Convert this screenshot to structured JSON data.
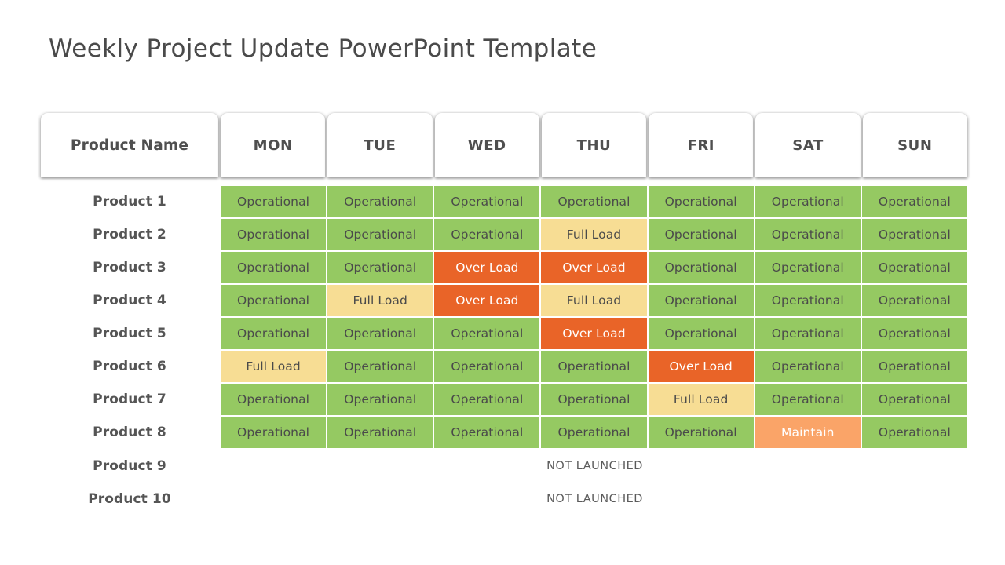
{
  "slide": {
    "title": "Weekly Project Update PowerPoint Template"
  },
  "colors": {
    "operational": "#95c962",
    "full_load": "#f7dd94",
    "over_load": "#e96428",
    "maintain": "#faa468",
    "title_text": "#4a4a4a",
    "header_text": "#4f4f4f",
    "row_label_text": "#555555",
    "background": "#ffffff"
  },
  "table": {
    "headers": [
      {
        "label": "Product Name",
        "name": "header-product-name"
      },
      {
        "label": "MON",
        "name": "header-mon"
      },
      {
        "label": "TUE",
        "name": "header-tue"
      },
      {
        "label": "WED",
        "name": "header-wed"
      },
      {
        "label": "THU",
        "name": "header-thu"
      },
      {
        "label": "FRI",
        "name": "header-fri"
      },
      {
        "label": "SAT",
        "name": "header-sat"
      },
      {
        "label": "SUN",
        "name": "header-sun"
      }
    ],
    "status_labels": {
      "operational": "Operational",
      "full_load": "Full Load",
      "over_load": "Over Load",
      "maintain": "Maintain",
      "not_launched": "NOT LAUNCHED"
    },
    "rows": [
      {
        "product": "Product 1",
        "launched": true,
        "cells": [
          {
            "label": "Operational",
            "status": "operational"
          },
          {
            "label": "Operational",
            "status": "operational"
          },
          {
            "label": "Operational",
            "status": "operational"
          },
          {
            "label": "Operational",
            "status": "operational"
          },
          {
            "label": "Operational",
            "status": "operational"
          },
          {
            "label": "Operational",
            "status": "operational"
          },
          {
            "label": "Operational",
            "status": "operational"
          }
        ]
      },
      {
        "product": "Product 2",
        "launched": true,
        "cells": [
          {
            "label": "Operational",
            "status": "operational"
          },
          {
            "label": "Operational",
            "status": "operational"
          },
          {
            "label": "Operational",
            "status": "operational"
          },
          {
            "label": "Full Load",
            "status": "full"
          },
          {
            "label": "Operational",
            "status": "operational"
          },
          {
            "label": "Operational",
            "status": "operational"
          },
          {
            "label": "Operational",
            "status": "operational"
          }
        ]
      },
      {
        "product": "Product 3",
        "launched": true,
        "cells": [
          {
            "label": "Operational",
            "status": "operational"
          },
          {
            "label": "Operational",
            "status": "operational"
          },
          {
            "label": "Over Load",
            "status": "over"
          },
          {
            "label": "Over Load",
            "status": "over"
          },
          {
            "label": "Operational",
            "status": "operational"
          },
          {
            "label": "Operational",
            "status": "operational"
          },
          {
            "label": "Operational",
            "status": "operational"
          }
        ]
      },
      {
        "product": "Product 4",
        "launched": true,
        "cells": [
          {
            "label": "Operational",
            "status": "operational"
          },
          {
            "label": "Full Load",
            "status": "full"
          },
          {
            "label": "Over Load",
            "status": "over"
          },
          {
            "label": "Full Load",
            "status": "full"
          },
          {
            "label": "Operational",
            "status": "operational"
          },
          {
            "label": "Operational",
            "status": "operational"
          },
          {
            "label": "Operational",
            "status": "operational"
          }
        ]
      },
      {
        "product": "Product 5",
        "launched": true,
        "cells": [
          {
            "label": "Operational",
            "status": "operational"
          },
          {
            "label": "Operational",
            "status": "operational"
          },
          {
            "label": "Operational",
            "status": "operational"
          },
          {
            "label": "Over Load",
            "status": "over"
          },
          {
            "label": "Operational",
            "status": "operational"
          },
          {
            "label": "Operational",
            "status": "operational"
          },
          {
            "label": "Operational",
            "status": "operational"
          }
        ]
      },
      {
        "product": "Product 6",
        "launched": true,
        "cells": [
          {
            "label": "Full Load",
            "status": "full"
          },
          {
            "label": "Operational",
            "status": "operational"
          },
          {
            "label": "Operational",
            "status": "operational"
          },
          {
            "label": "Operational",
            "status": "operational"
          },
          {
            "label": "Over Load",
            "status": "over"
          },
          {
            "label": "Operational",
            "status": "operational"
          },
          {
            "label": "Operational",
            "status": "operational"
          }
        ]
      },
      {
        "product": "Product 7",
        "launched": true,
        "cells": [
          {
            "label": "Operational",
            "status": "operational"
          },
          {
            "label": "Operational",
            "status": "operational"
          },
          {
            "label": "Operational",
            "status": "operational"
          },
          {
            "label": "Operational",
            "status": "operational"
          },
          {
            "label": "Full Load",
            "status": "full"
          },
          {
            "label": "Operational",
            "status": "operational"
          },
          {
            "label": "Operational",
            "status": "operational"
          }
        ]
      },
      {
        "product": "Product 8",
        "launched": true,
        "cells": [
          {
            "label": "Operational",
            "status": "operational"
          },
          {
            "label": "Operational",
            "status": "operational"
          },
          {
            "label": "Operational",
            "status": "operational"
          },
          {
            "label": "Operational",
            "status": "operational"
          },
          {
            "label": "Operational",
            "status": "operational"
          },
          {
            "label": "Maintain",
            "status": "maintain"
          },
          {
            "label": "Operational",
            "status": "operational"
          }
        ]
      },
      {
        "product": "Product 9",
        "launched": false,
        "note": "NOT LAUNCHED"
      },
      {
        "product": "Product 10",
        "launched": false,
        "note": "NOT LAUNCHED"
      }
    ]
  }
}
